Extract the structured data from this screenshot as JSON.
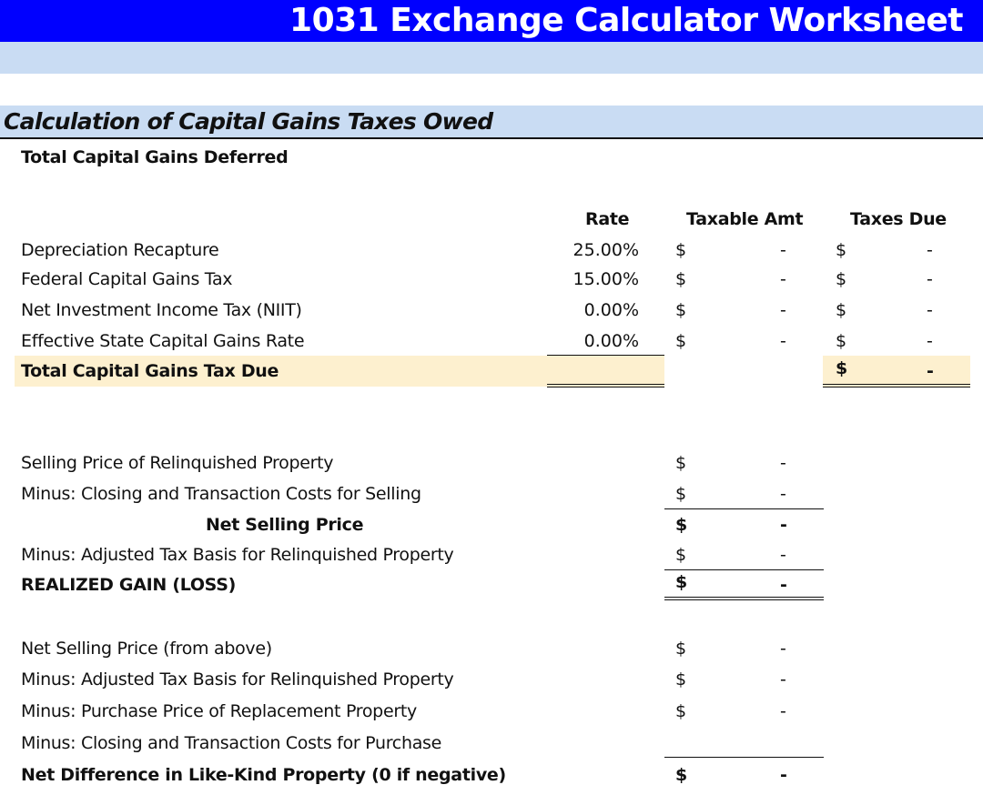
{
  "header": {
    "title": "1031 Exchange Calculator Worksheet"
  },
  "section": {
    "title": "Calculation of Capital Gains Taxes Owed"
  },
  "summary": {
    "label": "Total Capital Gains Deferred"
  },
  "tax_table": {
    "columns": {
      "rate": "Rate",
      "taxable": "Taxable Amt",
      "taxes": "Taxes Due"
    },
    "rows": [
      {
        "label": "Depreciation Recapture",
        "rate": "25.00%",
        "taxable_symbol": "$",
        "taxable_value": "-",
        "taxes_symbol": "$",
        "taxes_value": "-"
      },
      {
        "label": "Federal Capital Gains Tax",
        "rate": "15.00%",
        "taxable_symbol": "$",
        "taxable_value": "-",
        "taxes_symbol": "$",
        "taxes_value": "-"
      },
      {
        "label": "Net Investment Income Tax (NIIT)",
        "rate": "0.00%",
        "taxable_symbol": "$",
        "taxable_value": "-",
        "taxes_symbol": "$",
        "taxes_value": "-"
      },
      {
        "label": "Effective State Capital Gains Rate",
        "rate": "0.00%",
        "taxable_symbol": "$",
        "taxable_value": "-",
        "taxes_symbol": "$",
        "taxes_value": "-"
      }
    ],
    "total": {
      "label": "Total Capital Gains Tax Due",
      "taxes_symbol": "$",
      "taxes_value": "-"
    }
  },
  "gain_section": {
    "rows": [
      {
        "label": "Selling Price of Relinquished Property",
        "symbol": "$",
        "value": "-"
      },
      {
        "label": "Minus: Closing and Transaction Costs for Selling",
        "symbol": "$",
        "value": "-"
      },
      {
        "label": "Net Selling Price",
        "symbol": "$",
        "value": "-"
      },
      {
        "label": "Minus: Adjusted Tax Basis for Relinquished Property",
        "symbol": "$",
        "value": "-"
      },
      {
        "label": "REALIZED GAIN (LOSS)",
        "symbol": "$",
        "value": "-"
      }
    ]
  },
  "likekind_section": {
    "rows": [
      {
        "label": "Net Selling Price (from above)",
        "symbol": "$",
        "value": "-"
      },
      {
        "label": "Minus: Adjusted Tax Basis for Relinquished Property",
        "symbol": "$",
        "value": "-"
      },
      {
        "label": "Minus: Purchase Price of Replacement Property",
        "symbol": "$",
        "value": "-"
      },
      {
        "label": "Minus: Closing and Transaction Costs for Purchase",
        "symbol": "",
        "value": ""
      },
      {
        "label": "Net Difference in Like-Kind Property (0 if negative)",
        "symbol": "$",
        "value": "-"
      }
    ]
  },
  "colors": {
    "title_bar": "#0000ff",
    "light_band": "#c9dcf3",
    "total_highlight": "#fdf0cf"
  }
}
